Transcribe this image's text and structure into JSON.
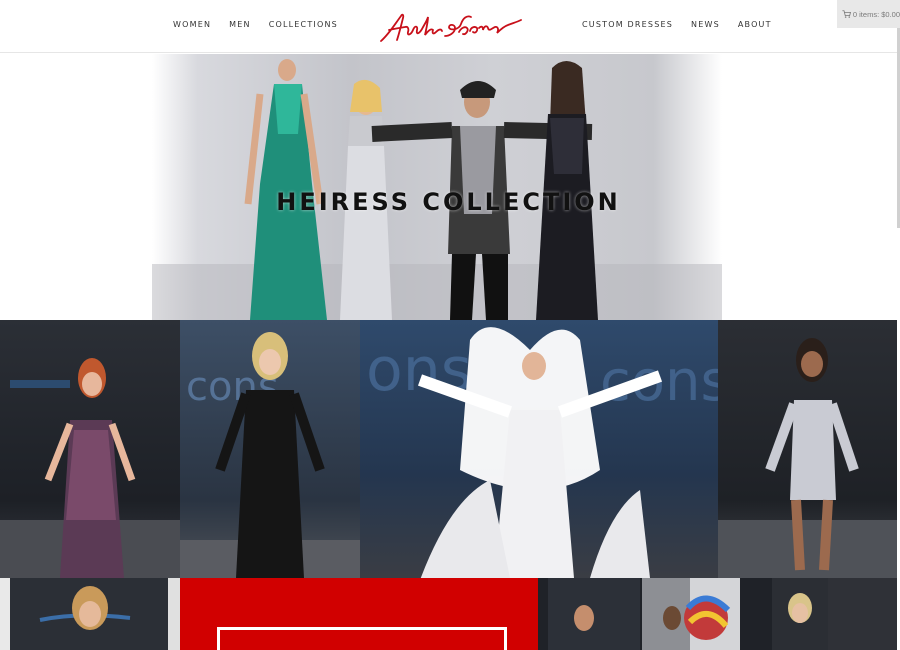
{
  "nav": {
    "left": [
      "WOMEN",
      "MEN",
      "COLLECTIONS"
    ],
    "right": [
      "CUSTOM DRESSES",
      "NEWS",
      "ABOUT"
    ]
  },
  "brand": {
    "color": "#c8101a"
  },
  "cart": {
    "label": "0 items: $0.00"
  },
  "hero": {
    "title": "HEIRESS COLLECTION"
  },
  "colors": {
    "promo": "#d10000"
  }
}
